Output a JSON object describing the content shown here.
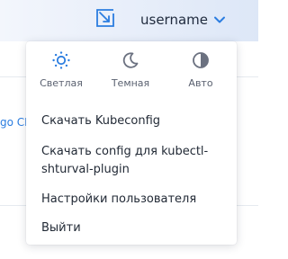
{
  "header": {
    "username": "username",
    "icons": {
      "expand": "expand-arrow-icon",
      "chevron": "chevron-down-icon"
    }
  },
  "background": {
    "partial_link_text": "go CD"
  },
  "dropdown": {
    "themes": [
      {
        "label": "Светлая",
        "icon": "sun-icon",
        "selected": true
      },
      {
        "label": "Темная",
        "icon": "moon-icon",
        "selected": false
      },
      {
        "label": "Авто",
        "icon": "half-circle-icon",
        "selected": false
      }
    ],
    "items": [
      {
        "label": "Скачать Kubeconfig"
      },
      {
        "label": "Скачать config для kubectl-shturval-plugin"
      },
      {
        "label": "Настройки пользователя"
      },
      {
        "label": "Выйти"
      }
    ]
  },
  "colors": {
    "accent": "#2b7de0",
    "text": "#222a36",
    "muted": "#5a6170",
    "inactive_icon": "#6b7180"
  }
}
